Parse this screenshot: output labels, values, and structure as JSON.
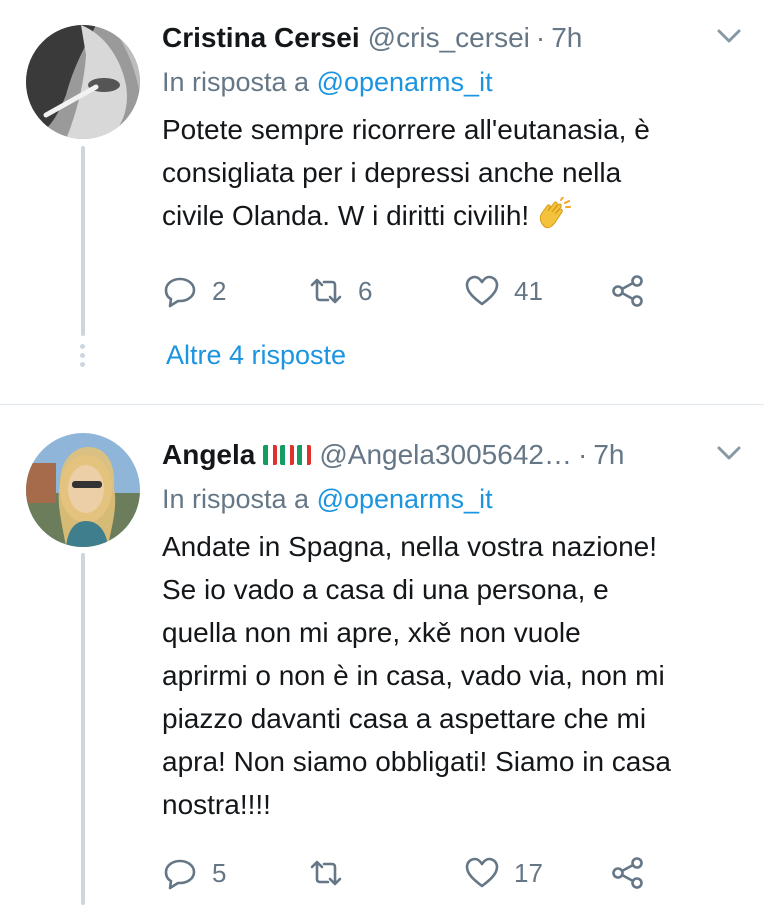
{
  "tweets": [
    {
      "name": "Cristina Cersei",
      "handle": "@cris_cersei",
      "separator": "·",
      "time": "7h",
      "reply_prefix": "In risposta a ",
      "reply_handle": "@openarms_it",
      "text": "Potete sempre ricorrere all'eutanasia, è\nconsigliata per i depressi anche nella\ncivile Olanda. W i diritti civilih! ",
      "emoji": "clapping-hands",
      "replies": "2",
      "retweets": "6",
      "likes": "41",
      "more_replies": "Altre 4 risposte"
    },
    {
      "name": "Angela",
      "flags": "🇮🇹🇮🇹🇮🇹",
      "handle": "@Angela3005642…",
      "separator": "·",
      "time": "7h",
      "reply_prefix": "In risposta a ",
      "reply_handle": "@openarms_it",
      "text": "Andate in Spagna, nella vostra nazione!\nSe io vado a casa di una persona, e\nquella non mi apre,  xkě non vuole\naprirmi o non è in casa, vado via, non mi\npiazzo davanti casa a aspettare che mi\napra! Non siamo obbligati! Siamo in casa\nnostra!!!!",
      "replies": "5",
      "retweets": "",
      "likes": "17"
    }
  ],
  "colors": {
    "link": "#1b95e0",
    "secondary": "#657786",
    "text": "#14171a",
    "divider": "#e1e8ed",
    "thread": "#cdd6dc"
  }
}
